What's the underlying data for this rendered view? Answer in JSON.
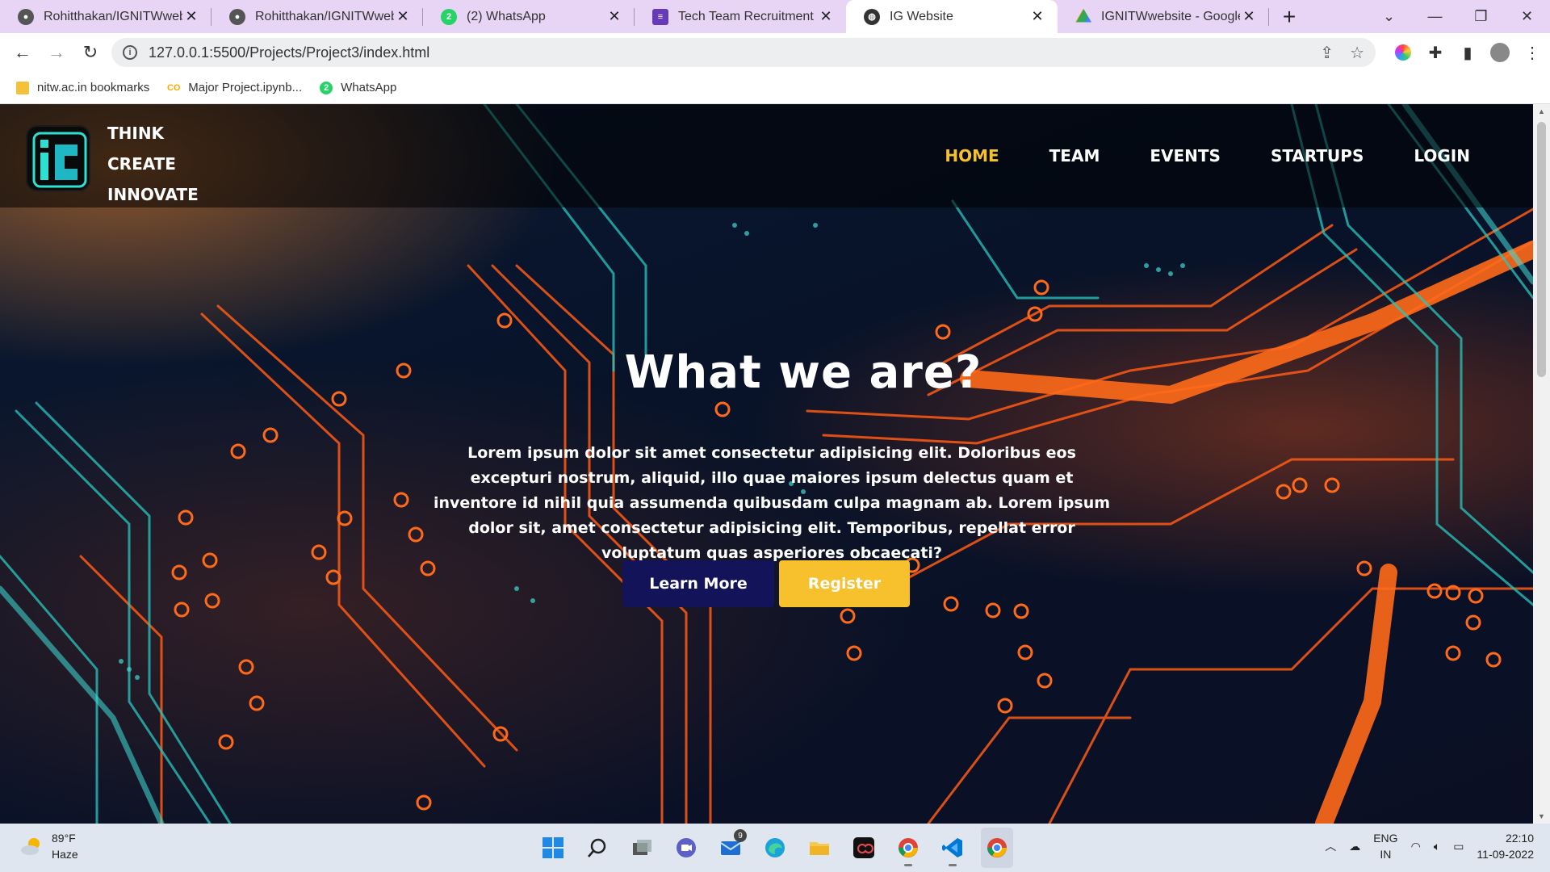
{
  "browser": {
    "tabs": [
      {
        "title": "Rohitthakan/IGNITWwebsit",
        "icon": "github-icon"
      },
      {
        "title": "Rohitthakan/IGNITWwebsit",
        "icon": "github-icon"
      },
      {
        "title": "(2) WhatsApp",
        "icon": "whatsapp-icon"
      },
      {
        "title": "Tech Team Recruitment Tasl",
        "icon": "forms-icon"
      },
      {
        "title": "IG Website",
        "icon": "globe-icon"
      },
      {
        "title": "IGNITWwebsite - Google D",
        "icon": "drive-icon"
      }
    ],
    "active_tab": 4,
    "url": "127.0.0.1:5500/Projects/Project3/index.html",
    "bookmarks": [
      {
        "label": "nitw.ac.in bookmarks",
        "icon": "folder-icon"
      },
      {
        "label": "Major Project.ipynb...",
        "icon": "colab-icon"
      },
      {
        "label": "WhatsApp",
        "icon": "whatsapp-icon"
      }
    ],
    "whatsapp_badge": "2"
  },
  "site": {
    "tagline": [
      "THINK",
      "CREATE",
      "INNOVATE"
    ],
    "nav": [
      {
        "label": "HOME",
        "active": true
      },
      {
        "label": "TEAM",
        "active": false
      },
      {
        "label": "EVENTS",
        "active": false
      },
      {
        "label": "STARTUPS",
        "active": false
      },
      {
        "label": "LOGIN",
        "active": false
      }
    ],
    "hero": {
      "title": "What we are?",
      "text": "Lorem ipsum dolor sit amet consectetur adipisicing elit. Doloribus eos excepturi nostrum, aliquid, illo quae maiores ipsum delectus quam et inventore id nihil quia assumenda quibusdam culpa magnam ab. Lorem ipsum dolor sit, amet consectetur adipisicing elit. Temporibus, repellat error voluptatum quas asperiores obcaecati?",
      "learn_more": "Learn More",
      "register": "Register"
    },
    "colors": {
      "accent": "#f6c12c",
      "button_dark": "#13135a"
    }
  },
  "taskbar": {
    "weather": {
      "temp": "89°F",
      "condition": "Haze"
    },
    "mail_badge": "9",
    "language": "ENG",
    "region": "IN",
    "time": "22:10",
    "date": "11-09-2022"
  }
}
